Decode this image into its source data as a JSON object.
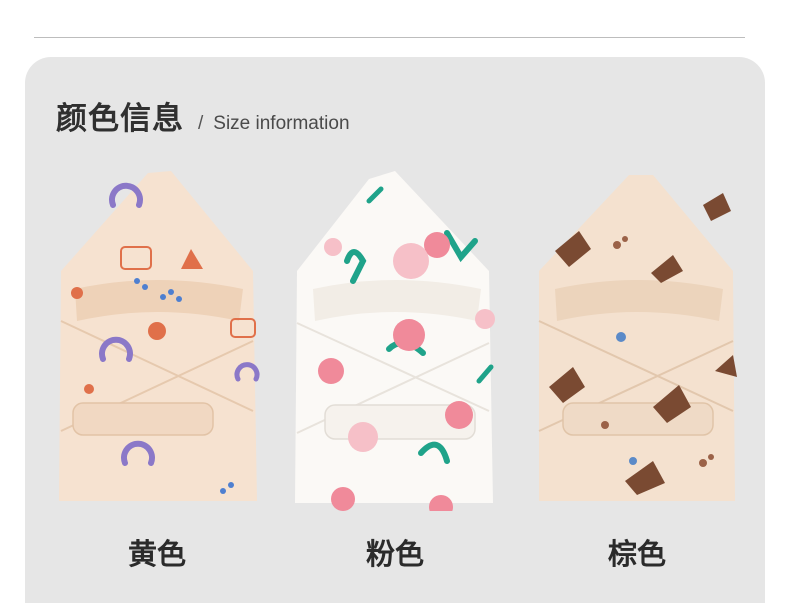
{
  "section": {
    "title_cn": "颜色信息",
    "separator": "/",
    "title_en": "Size information"
  },
  "products": [
    {
      "label": "黄色",
      "base_color": "#f6e2d0",
      "accent_colors": [
        "#8b78c8",
        "#e0704a",
        "#4e7fd0"
      ]
    },
    {
      "label": "粉色",
      "base_color": "#fbf9f6",
      "accent_colors": [
        "#f08a9a",
        "#1fa38a",
        "#f6c0c8"
      ]
    },
    {
      "label": "棕色",
      "base_color": "#f4e1cf",
      "accent_colors": [
        "#7a4a32",
        "#9b6248",
        "#5b8ac8"
      ]
    }
  ]
}
